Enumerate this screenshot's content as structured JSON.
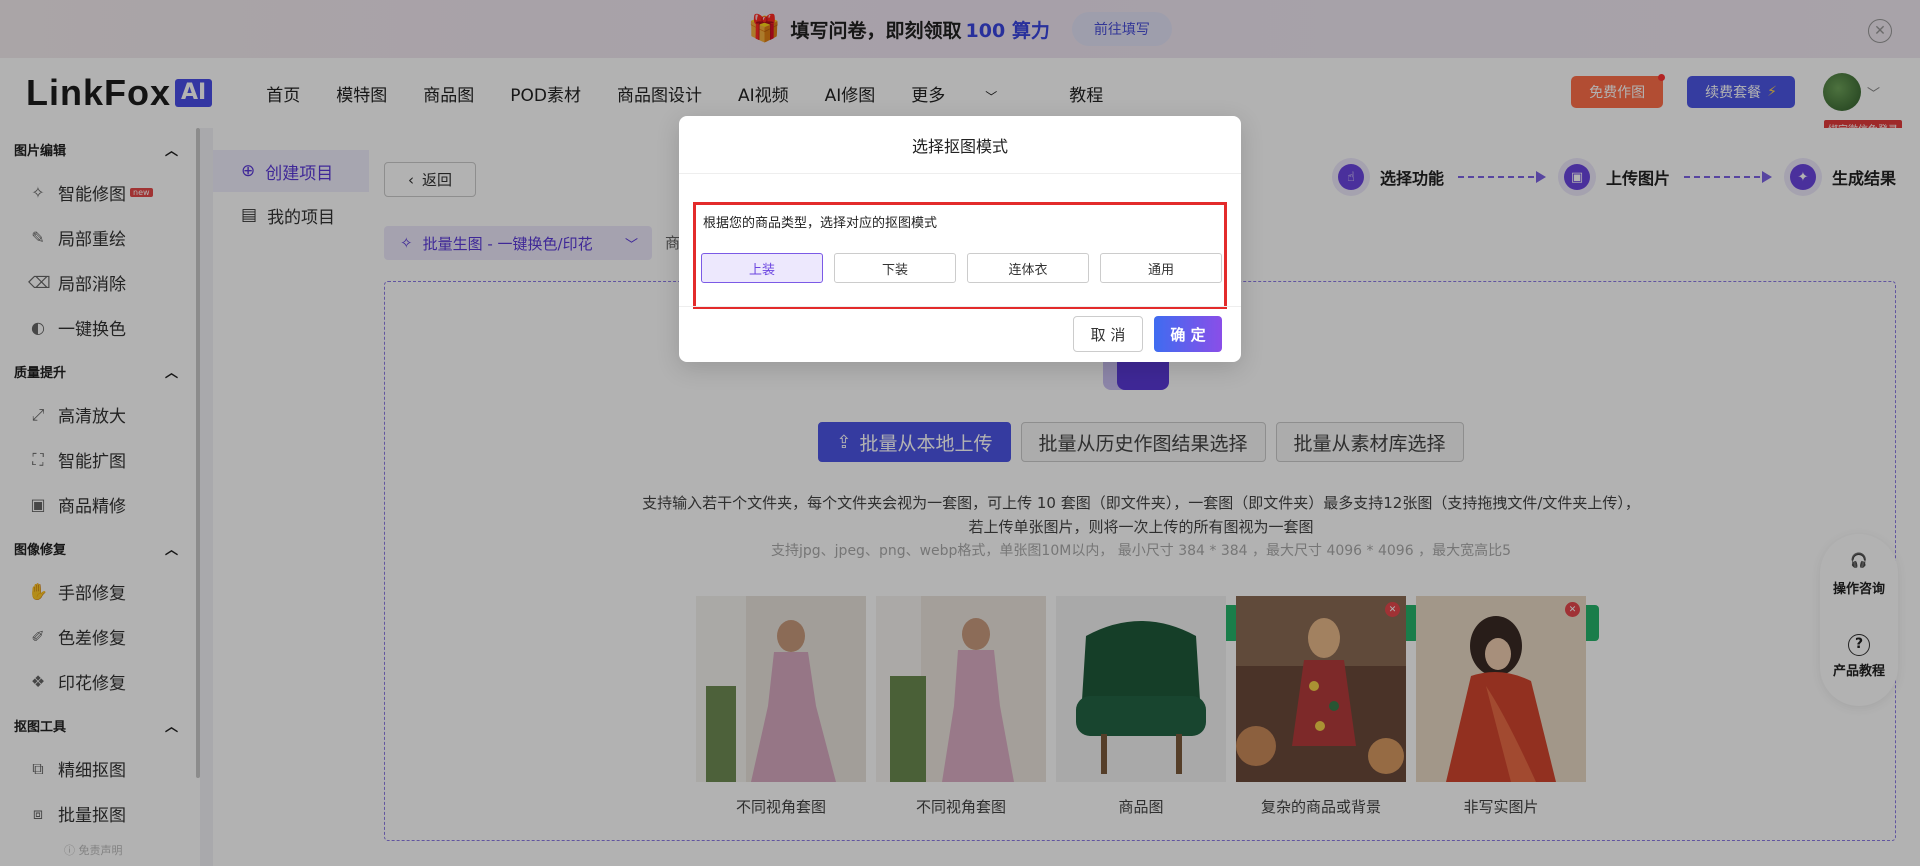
{
  "banner": {
    "text": "填写问卷，即刻领取",
    "highlight": "100 算力",
    "button": "前往填写"
  },
  "header": {
    "logo_text": "LinkFox",
    "logo_badge": "AI",
    "nav": [
      "首页",
      "模特图",
      "商品图",
      "POD素材",
      "商品图设计",
      "AI视频",
      "AI修图",
      "更多",
      "教程"
    ],
    "free_button": "免费作图",
    "renew_button": "续费套餐",
    "bind_tag": "绑定微信免登录"
  },
  "sidebar": {
    "sections": [
      {
        "title": "图片编辑",
        "items": [
          {
            "label": "智能修图",
            "icon": "magic-wand-icon",
            "new": "new"
          },
          {
            "label": "局部重绘",
            "icon": "brush-icon"
          },
          {
            "label": "局部消除",
            "icon": "eraser-icon"
          },
          {
            "label": "一键换色",
            "icon": "palette-icon"
          }
        ]
      },
      {
        "title": "质量提升",
        "items": [
          {
            "label": "高清放大",
            "icon": "expand-icon"
          },
          {
            "label": "智能扩图",
            "icon": "extend-icon"
          },
          {
            "label": "商品精修",
            "icon": "refine-icon"
          }
        ]
      },
      {
        "title": "图像修复",
        "items": [
          {
            "label": "手部修复",
            "icon": "hand-icon"
          },
          {
            "label": "色差修复",
            "icon": "color-fix-icon"
          },
          {
            "label": "印花修复",
            "icon": "print-fix-icon"
          }
        ]
      },
      {
        "title": "抠图工具",
        "items": [
          {
            "label": "精细抠图",
            "icon": "cutout-icon"
          },
          {
            "label": "批量抠图",
            "icon": "batch-cutout-icon"
          }
        ]
      }
    ],
    "disclaimer": "免责声明"
  },
  "subsidebar": {
    "create": "创建项目",
    "mine": "我的项目"
  },
  "main": {
    "back": "返回",
    "steps": [
      "选择功能",
      "上传图片",
      "生成结果"
    ],
    "mode_label": "批量生图 - 一键换色/印花",
    "mode_extra": "商",
    "upload_buttons": [
      "批量从本地上传",
      "批量从历史作图结果选择",
      "批量从素材库选择"
    ],
    "desc_line1": "支持输入若干个文件夹，每个文件夹会视为一套图，可上传 10 套图（即文件夹），一套图（即文件夹）最多支持12张图（支持拖拽文件/文件夹上传），",
    "desc_line2": "若上传单张图片，则将一次上传的所有图视为一套图",
    "desc_line3": "支持jpg、jpeg、png、webp格式，单张图10M以内， 最小尺寸 384 * 384 ，最大尺寸 4096 * 4096 ，最大宽高比5",
    "samples": [
      {
        "label": "不同视角套图",
        "status": "ok"
      },
      {
        "label": "不同视角套图",
        "status": "ok"
      },
      {
        "label": "商品图",
        "status": "ok"
      },
      {
        "label": "复杂的商品或背景",
        "status": "no"
      },
      {
        "label": "非写实图片",
        "status": "no"
      }
    ]
  },
  "help": {
    "consult": "操作咨询",
    "tutorial": "产品教程"
  },
  "modal": {
    "title": "选择抠图模式",
    "prompt": "根据您的商品类型，选择对应的抠图模式",
    "options": [
      "上装",
      "下装",
      "连体衣",
      "通用"
    ],
    "selected": "上装",
    "cancel": "取 消",
    "confirm": "确 定"
  },
  "colors": {
    "accent": "#5b3ad9",
    "primary_blue": "#4d55e6",
    "highlight_border": "#e32b2b"
  }
}
